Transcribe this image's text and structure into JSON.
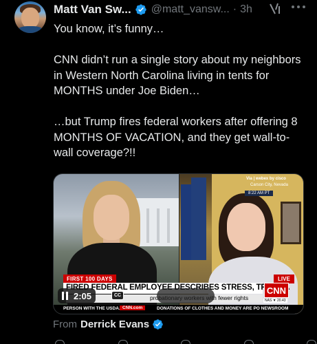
{
  "author": {
    "name": "Matt Van Sw...",
    "handle": "@matt_vansw...",
    "separator": "·",
    "time": "3h"
  },
  "icons": {
    "verified": "verified-badge-icon",
    "grok": "grok-icon",
    "more": "more-options-icon",
    "pause": "pause-icon",
    "captions": "closed-captions-icon"
  },
  "tweet": {
    "line1": "You know, it’s funny…",
    "line2": "CNN didn’t run a single story about my neighbors in Western North Carolina living in tents for MONTHS under Joe Biden…",
    "line3": "…but Trump fires federal workers after offering 8 MONTHS OF VACATION, and they get wall-to-wall coverage?!!"
  },
  "video": {
    "via": "Via | webex by cisco",
    "location": "Carson City, Nevada",
    "local_time": "8:22 AM PT",
    "badge": "FIRST 100 DAYS",
    "live": "LIVE",
    "headline": "FIRED FEDERAL EMPLOYEE DESCRIBES STRESS, TRAUMA",
    "subhead": "probationary workers with fewer rights",
    "network": "CNN",
    "market": "NAS ▼ 20.43",
    "ticker_a": "PERSON WITH THE USDA.",
    "ticker_brand": "CNN.com",
    "ticker_b": "DONATIONS OF CLOTHES AND MONEY ARE PO NEWSROOM",
    "duration": "2:05",
    "cc_label": "CC"
  },
  "source": {
    "label": "From",
    "name": "Derrick Evans"
  },
  "colors": {
    "background": "#000000",
    "text": "#e7e9ea",
    "muted": "#71767b",
    "verified": "#1d9bf0",
    "cnn_red": "#cc0000"
  }
}
